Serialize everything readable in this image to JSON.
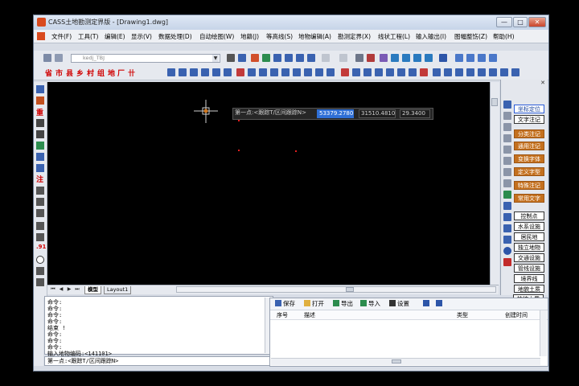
{
  "window": {
    "title": "CASS土地勘测定界版 - [Drawing1.dwg]",
    "min": "—",
    "max": "□",
    "close": "✕"
  },
  "menu": [
    "文件(F)",
    "工具(T)",
    "编辑(E)",
    "显示(V)",
    "数据处理(D)",
    "自动绘图(W)",
    "地籍(J)",
    "等高线(S)",
    "地物编辑(A)",
    "勘测定界(X)",
    "线状工程(L)",
    "输入输出(I)",
    "图幅整饬(Z)",
    "帮助(H)"
  ],
  "layer_combo": {
    "value": "kedj_TBJ"
  },
  "region_toolbar": [
    "省",
    "市",
    "县",
    "乡",
    "村",
    "组",
    "地",
    "厂",
    "卄"
  ],
  "left_toolbar_text": [
    "重",
    "注",
    ".91"
  ],
  "dynamic_input": {
    "prompt": "第一点:<跟踪T/区间跟踪N>",
    "x": "53379.2780",
    "y": "31510.4810",
    "z": "29.3400"
  },
  "layout_tabs": [
    "模型",
    "Layout1"
  ],
  "right_panel": {
    "close": "✕",
    "buttons": [
      "坐标定位",
      "文字注记",
      "分类注记",
      "通用注记",
      "变换字体",
      "定义字型",
      "特殊注记",
      "常用文字",
      "控制点",
      "水系设施",
      "居民地",
      "独立地物",
      "交通设施",
      "管线设施",
      "境界线",
      "地貌土质",
      "植被土质"
    ]
  },
  "command_history": [
    "命令:",
    "命令:",
    "命令:",
    "命令:",
    "结束 !",
    "命令:",
    "命令:",
    "命令:",
    "输入地物编码:<141101>"
  ],
  "command_prompt": "第一点:<跟踪T/区间跟踪N>",
  "lower_panel": {
    "toolbar": [
      "保存",
      "打开",
      "导出",
      "导入",
      "设置"
    ],
    "columns": [
      "序号",
      "描述",
      "类型",
      "创建时间"
    ]
  }
}
